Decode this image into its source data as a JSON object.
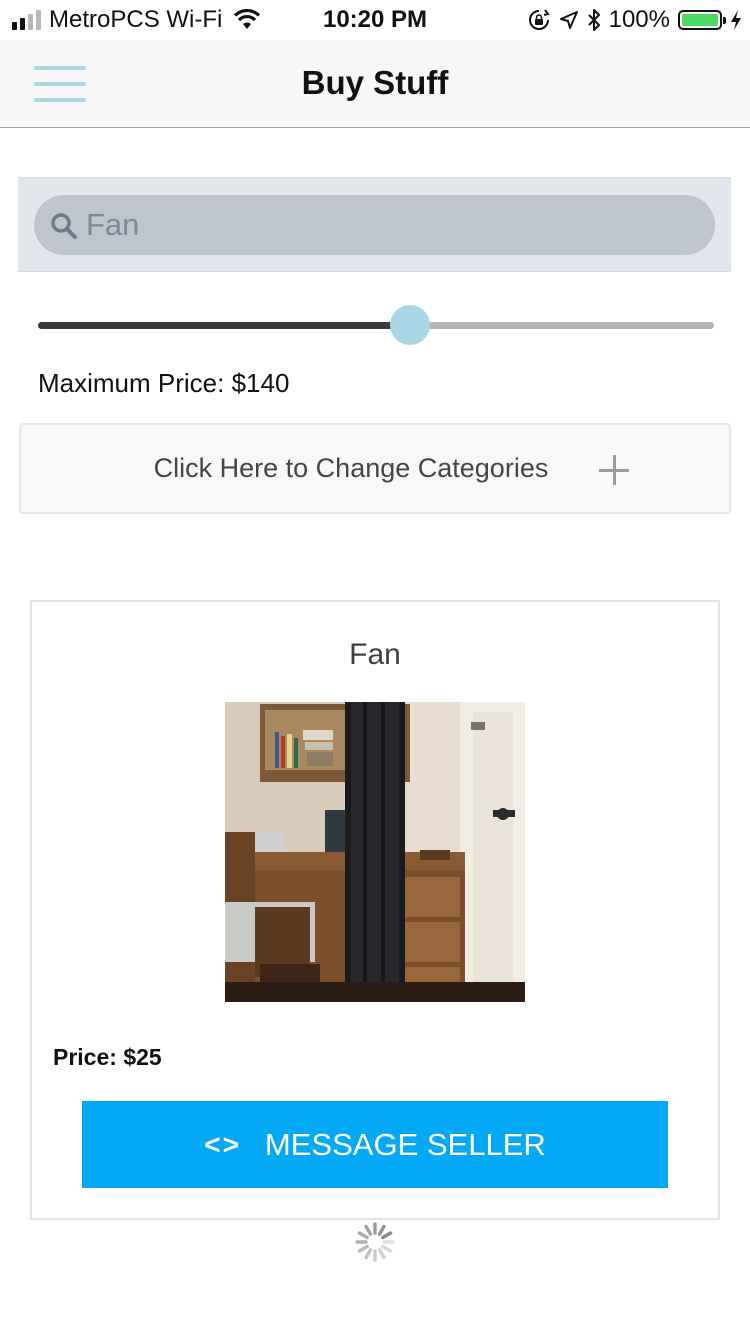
{
  "status_bar": {
    "carrier": "MetroPCS Wi-Fi",
    "time": "10:20 PM",
    "battery_percent": "100%",
    "battery_level": 1.0,
    "signal_bars_total": 4,
    "signal_bars_active": 2,
    "icons": [
      "wifi-icon",
      "orientation-lock-icon",
      "location-arrow-icon",
      "bluetooth-icon",
      "battery-icon",
      "charging-bolt-icon"
    ]
  },
  "navbar": {
    "title": "Buy Stuff",
    "menu_icon": "hamburger-menu-icon",
    "menu_color": "#a6d8e8"
  },
  "search": {
    "placeholder": "Fan",
    "value": "",
    "icon": "search-icon"
  },
  "price_filter": {
    "label": "Maximum Price: $140",
    "slider_fraction": 0.55,
    "thumb_color": "#a8d6e5"
  },
  "categories": {
    "label": "Click Here to Change Categories",
    "icon": "plus-icon"
  },
  "listing": {
    "title": "Fan",
    "image_alt_icon": "product-photo",
    "price": "Price: $25",
    "button_label": "MESSAGE SELLER",
    "button_icon": "code-brackets-icon",
    "button_color": "#03a9f4"
  },
  "loading": {
    "icon": "loading-spinner-icon"
  }
}
